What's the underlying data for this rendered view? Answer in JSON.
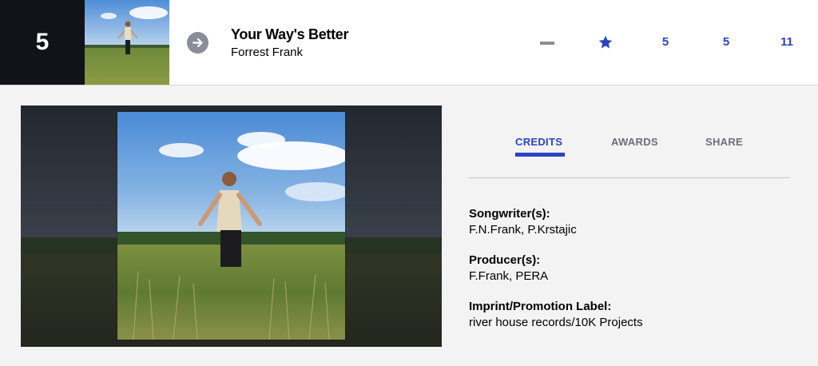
{
  "row": {
    "rank": "5",
    "title": "Your Way's Better",
    "artist": "Forrest Frank",
    "stats": [
      "5",
      "5",
      "11"
    ]
  },
  "tabs": [
    {
      "label": "CREDITS",
      "active": true
    },
    {
      "label": "AWARDS",
      "active": false
    },
    {
      "label": "SHARE",
      "active": false
    }
  ],
  "credits": [
    {
      "label": "Songwriter(s):",
      "value": "F.N.Frank, P.Krstajic"
    },
    {
      "label": "Producer(s):",
      "value": "F.Frank, PERA"
    },
    {
      "label": "Imprint/Promotion Label:",
      "value": "river house records/10K Projects"
    }
  ],
  "icons": {
    "expand": "arrow-right-circle-icon",
    "last_week": "dash-icon",
    "peak": "star-icon"
  },
  "colors": {
    "accent": "#2b44c4",
    "rank_bg": "#11121a",
    "muted": "#898c99"
  }
}
